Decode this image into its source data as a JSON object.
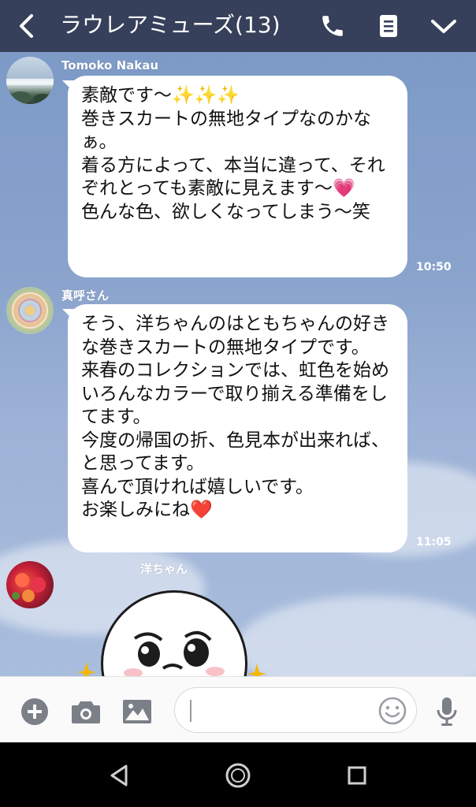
{
  "header": {
    "title": "ラウレアミューズ(13)"
  },
  "messages": [
    {
      "sender": "Tomoko Nakau",
      "text": "素敵です〜✨✨✨\n巻きスカートの無地タイプなのかなぁ。\n着る方によって、本当に違って、それぞれとっても素敵に見えます〜💗\n色んな色、欲しくなってしまう〜笑",
      "time": "10:50"
    },
    {
      "sender": "真呼さん",
      "text": "そう、洋ちゃんのはともちゃんの好きな巻きスカートの無地タイプです。\n来春のコレクションでは、虹色を始めいろんなカラーで取り揃える準備をしてます。\n今度の帰国の折、色見本が出来れば、と思ってます。\n喜んで頂ければ嬉しいです。\nお楽しみにね❤️",
      "time": "11:05"
    },
    {
      "sender": "洋ちゃん"
    }
  ],
  "colors": {
    "header_bg": "#37405a",
    "chat_bg": "#89a3cc",
    "bubble_bg": "#ffffff",
    "inputbar_bg": "#fafafa",
    "icon_gray": "#7b7f87"
  },
  "icons": {
    "header": [
      "back-icon",
      "phone-icon",
      "notes-icon",
      "chevron-down-icon"
    ],
    "input": [
      "plus-icon",
      "camera-icon",
      "image-icon",
      "emoji-icon",
      "mic-icon"
    ],
    "nav": [
      "nav-back-icon",
      "nav-home-icon",
      "nav-recents-icon"
    ]
  }
}
